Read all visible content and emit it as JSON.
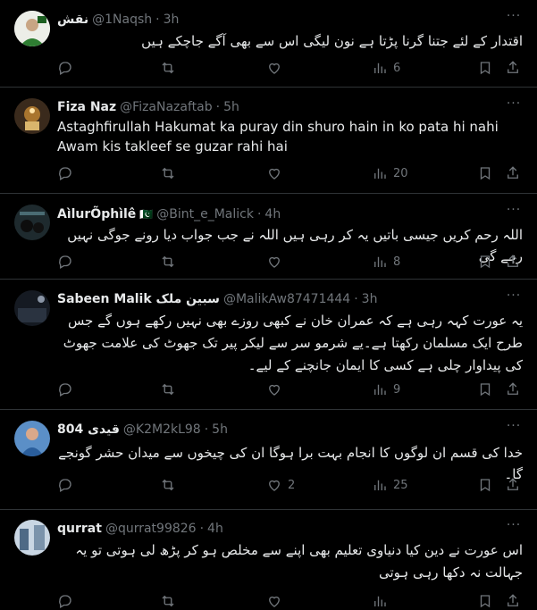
{
  "tweets": [
    {
      "name": "نقش",
      "handle": "@1Naqsh",
      "time": "3h",
      "text": "اقتدار کے لئے جتنا گرنا پڑتا ہے نون لیگی اس سے بھی آگے جاچکے ہیں",
      "dir": "rtl",
      "replies": "",
      "retweets": "",
      "likes": "",
      "views": "6"
    },
    {
      "name": "Fiza Naz",
      "handle": "@FizaNazaftab",
      "time": "5h",
      "text": "Astaghfirullah Hakumat ka puray din shuro hain in ko pata hi nahi Awam kis takleef se guzar rahi hai",
      "dir": "ltr",
      "replies": "",
      "retweets": "",
      "likes": "",
      "views": "20"
    },
    {
      "name": "AìlurÕphìlê",
      "flag": "🇵🇰",
      "handle": "@Bint_e_Malick",
      "time": "4h",
      "text": "اللہ رحم کریں جیسی باتیں یہ کر رہی ہیں اللہ نے جب جواب دیا رونے جوگی نہیں رہے گی",
      "dir": "rtl",
      "replies": "",
      "retweets": "",
      "likes": "",
      "views": "8"
    },
    {
      "name": "Sabeen Malik سبین ملک",
      "handle": "@MalikAw87471444",
      "time": "3h",
      "text": "یہ عورت کہہ رہی ہے کہ عمران خان نے کبھی روزے بھی نہیں رکھے ہوں گے جس طرح ایک مسلمان رکھتا ہے۔یے شرمو سر سے لیکر پیر تک جھوٹ کی علامت جھوٹ کی پیداوار چلی ہے کسی کا ایمان جانچنے کے لیے۔",
      "dir": "rtl",
      "replies": "",
      "retweets": "",
      "likes": "",
      "views": "9"
    },
    {
      "name": "804 قیدی",
      "handle": "@K2M2kL98",
      "time": "5h",
      "text": "خدا کی قسم ان لوگوں کا انجام بہت برا ہوگا ان کی چیخوں سے میدان حشر گونجے گا۔",
      "dir": "rtl",
      "replies": "",
      "retweets": "",
      "likes": "2",
      "views": "25"
    },
    {
      "name": "qurrat",
      "handle": "@qurrat99826",
      "time": "4h",
      "text": "اس عورت نے دین کیا دنیاوی تعلیم بھی اپنے سے مخلص ہو کر پڑھ لی ہوتی تو یہ جہالت نہ دکھا رہی ہوتی",
      "dir": "rtl",
      "replies": "",
      "retweets": "",
      "likes": "",
      "views": ""
    }
  ],
  "dot": "·",
  "colors": {
    "background": "#000000",
    "text": "#e7e9ea",
    "muted": "#71767b",
    "divider": "#2f3336"
  }
}
